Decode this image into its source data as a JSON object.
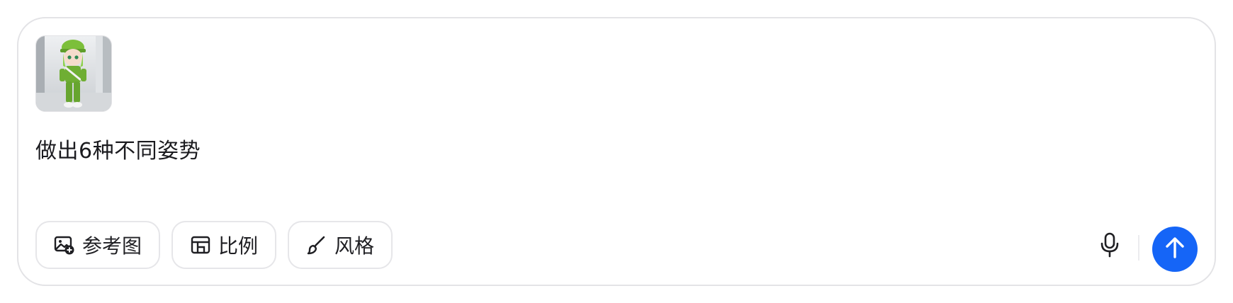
{
  "composer": {
    "attachment": {
      "kind": "image",
      "icon": "character-thumbnail"
    },
    "prompt_text": "做出6种不同姿势"
  },
  "toolbar": {
    "reference_image_label": "参考图",
    "reference_image_icon": "image-add-icon",
    "ratio_label": "比例",
    "ratio_icon": "layout-icon",
    "style_label": "风格",
    "style_icon": "brush-icon"
  },
  "actions": {
    "mic_icon": "microphone-icon",
    "send_icon": "arrow-up-icon",
    "send_color": "#1565f7"
  }
}
